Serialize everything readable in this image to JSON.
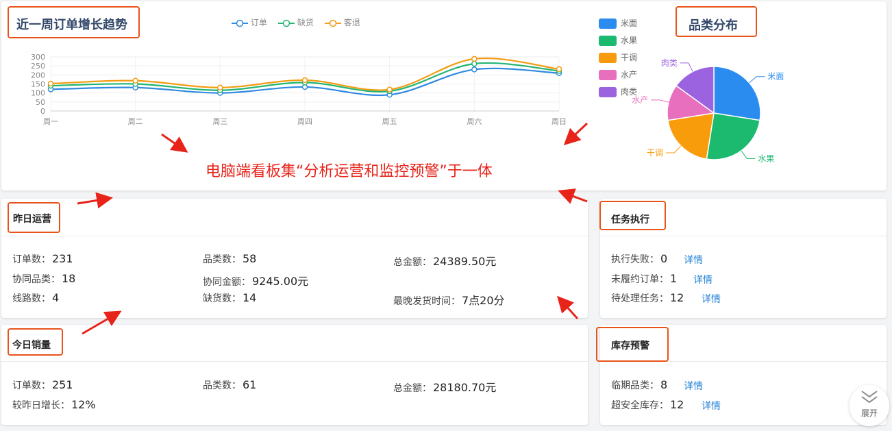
{
  "weekly": {
    "title": "近一周订单增长趋势",
    "legend": [
      {
        "name": "订单",
        "color": "#2f8ae0"
      },
      {
        "name": "缺货",
        "color": "#22b573"
      },
      {
        "name": "客退",
        "color": "#f39c12"
      }
    ]
  },
  "pie": {
    "title": "品类分布",
    "legend": [
      {
        "name": "米面",
        "color": "#2b8cf0"
      },
      {
        "name": "水果",
        "color": "#1cba6e"
      },
      {
        "name": "干调",
        "color": "#f99c0c"
      },
      {
        "name": "水产",
        "color": "#e76fbe"
      },
      {
        "name": "肉类",
        "color": "#9b63e0"
      }
    ]
  },
  "chart_data": [
    {
      "type": "line",
      "x": [
        "周一",
        "周二",
        "周三",
        "周四",
        "周五",
        "周六",
        "周日"
      ],
      "ylim": [
        0,
        300
      ],
      "yticks": [
        "300",
        "250",
        "200",
        "150",
        "100",
        "50",
        "0"
      ],
      "series": [
        {
          "name": "订单",
          "values": [
            120,
            130,
            100,
            133,
            90,
            230,
            210
          ]
        },
        {
          "name": "缺货",
          "values": [
            140,
            150,
            115,
            158,
            110,
            262,
            222
          ]
        },
        {
          "name": "客退",
          "values": [
            152,
            168,
            130,
            171,
            119,
            289,
            232
          ]
        }
      ],
      "title": "近一周订单增长趋势"
    },
    {
      "type": "pie",
      "categories": [
        "米面",
        "水果",
        "干调",
        "水产",
        "肉类"
      ],
      "values": [
        27.5,
        25,
        20,
        12.5,
        15
      ]
    }
  ],
  "annotation": "电脑端看板集“分析运营和监控预警”于一体",
  "yesterday": {
    "title": "昨日运营",
    "stats": [
      {
        "label": "订单数：",
        "value": "231"
      },
      {
        "label": "品类数：",
        "value": "58"
      },
      {
        "label": "总金额：",
        "value": "24389.50元"
      },
      {
        "label": "协同品类：",
        "value": "18"
      },
      {
        "label": "协同金额：",
        "value": "9245.00元"
      },
      {
        "label": "线路数：",
        "value": "4"
      },
      {
        "label": "缺货数：",
        "value": "14"
      },
      {
        "label": "最晚发货时间：",
        "value": "7点20分"
      }
    ]
  },
  "today": {
    "title": "今日销量",
    "stats": [
      {
        "label": "订单数：",
        "value": "251"
      },
      {
        "label": "品类数：",
        "value": "61"
      },
      {
        "label": "总金额：",
        "value": "28180.70元"
      },
      {
        "label": "较昨日增长：",
        "value": "12%"
      }
    ]
  },
  "tasks": {
    "title": "任务执行",
    "items": [
      {
        "label": "执行失败：",
        "value": "0",
        "link": "详情"
      },
      {
        "label": "未履约订单：",
        "value": "1",
        "link": "详情"
      },
      {
        "label": "待处理任务：",
        "value": "12",
        "link": "详情"
      }
    ]
  },
  "inventory": {
    "title": "库存预警",
    "items": [
      {
        "label": "临期品类：",
        "value": "8",
        "link": "详情"
      },
      {
        "label": "超安全库存：",
        "value": "12",
        "link": "详情"
      }
    ]
  },
  "expand_label": "展开"
}
